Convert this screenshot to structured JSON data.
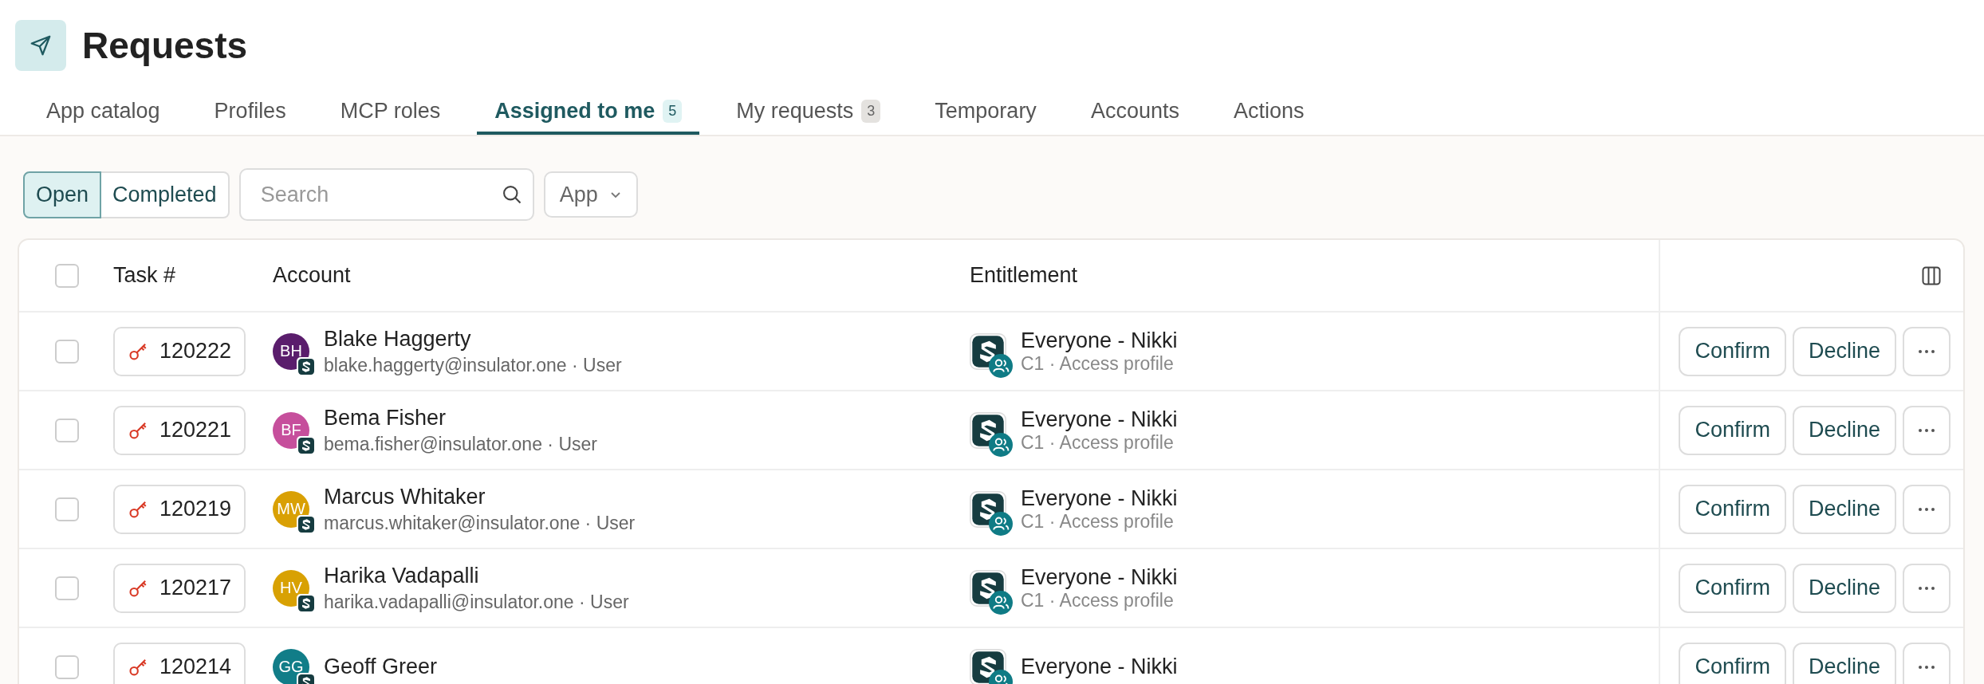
{
  "page": {
    "title": "Requests"
  },
  "tabs": [
    {
      "label": "App catalog",
      "selected": false
    },
    {
      "label": "Profiles",
      "selected": false
    },
    {
      "label": "MCP roles",
      "selected": false
    },
    {
      "label": "Assigned to me",
      "selected": true,
      "count": "5"
    },
    {
      "label": "My requests",
      "selected": false,
      "count": "3"
    },
    {
      "label": "Temporary",
      "selected": false
    },
    {
      "label": "Accounts",
      "selected": false
    },
    {
      "label": "Actions",
      "selected": false
    }
  ],
  "filters": {
    "segments": [
      {
        "label": "Open",
        "selected": true
      },
      {
        "label": "Completed",
        "selected": false
      }
    ],
    "search": {
      "placeholder": "Search"
    },
    "app_filter": {
      "label": "App"
    }
  },
  "table": {
    "select_all": {
      "checked": false
    },
    "columns": [
      "Task #",
      "Account",
      "Entitlement"
    ],
    "rows": [
      {
        "selected": false,
        "task": "120222",
        "name": "Blake Haggerty",
        "initials": "BH",
        "color": "#5a1d6c",
        "detail": "blake.haggerty@insulator.one · User",
        "entitlement": "Everyone - Nikki",
        "entitlement_detail": "C1 · Access profile",
        "actions": [
          "Confirm",
          "Decline"
        ]
      },
      {
        "selected": false,
        "task": "120221",
        "name": "Bema Fisher",
        "initials": "BF",
        "color": "#c64f9c",
        "detail": "bema.fisher@insulator.one · User",
        "entitlement": "Everyone - Nikki",
        "entitlement_detail": "C1 · Access profile",
        "actions": [
          "Confirm",
          "Decline"
        ]
      },
      {
        "selected": false,
        "task": "120219",
        "name": "Marcus Whitaker",
        "initials": "MW",
        "color": "#d9a004",
        "detail": "marcus.whitaker@insulator.one · User",
        "entitlement": "Everyone - Nikki",
        "entitlement_detail": "C1 · Access profile",
        "actions": [
          "Confirm",
          "Decline"
        ]
      },
      {
        "selected": false,
        "task": "120217",
        "name": "Harika Vadapalli",
        "initials": "HV",
        "color": "#d8a103",
        "detail": "harika.vadapalli@insulator.one · User",
        "entitlement": "Everyone - Nikki",
        "entitlement_detail": "C1 · Access profile",
        "actions": [
          "Confirm",
          "Decline"
        ]
      },
      {
        "selected": false,
        "task": "120214",
        "name": "Geoff Greer",
        "initials": "GG",
        "color": "#117d88",
        "entitlement": "Everyone - Nikki",
        "actions": [
          "Confirm",
          "Decline"
        ]
      }
    ]
  }
}
